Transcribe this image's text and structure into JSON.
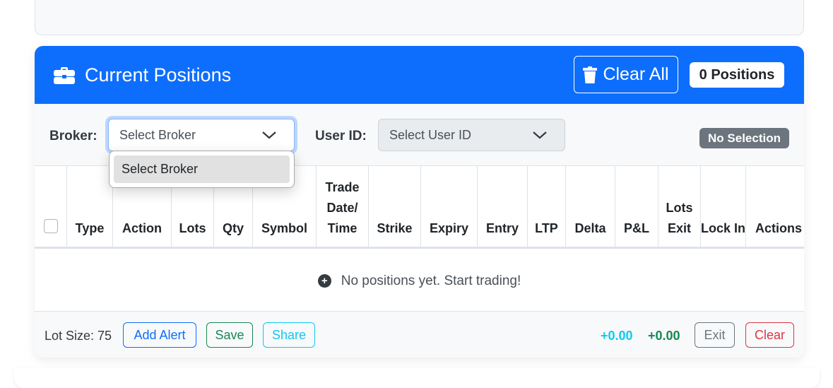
{
  "header": {
    "title": "Current Positions",
    "clear_all_label": "Clear All",
    "positions_badge": "0 Positions",
    "color": "#0d6efd"
  },
  "filters": {
    "broker_label": "Broker:",
    "broker_value": "Select Broker",
    "broker_options": [
      "Select Broker"
    ],
    "user_label": "User ID:",
    "user_value": "Select User ID",
    "selection_badge": "No Selection"
  },
  "table": {
    "columns": [
      {
        "label": "Type"
      },
      {
        "label": "Action"
      },
      {
        "label": "Lots"
      },
      {
        "label": "Qty"
      },
      {
        "label": "Symbol"
      },
      {
        "label": "Trade Date/ Time"
      },
      {
        "label": "Strike"
      },
      {
        "label": "Expiry"
      },
      {
        "label": "Entry"
      },
      {
        "label": "LTP"
      },
      {
        "label": "Delta"
      },
      {
        "label": "P&L"
      },
      {
        "label": "Lots Exit"
      },
      {
        "label": "Lock In"
      },
      {
        "label": "Actions"
      }
    ],
    "empty_message": "No positions yet. Start trading!"
  },
  "footer": {
    "lot_size": "Lot Size: 75",
    "add_alert_label": "Add Alert",
    "save_label": "Save",
    "share_label": "Share",
    "pnl_primary": "+0.00",
    "pnl_secondary": "+0.00",
    "exit_label": "Exit",
    "clear_label": "Clear"
  }
}
